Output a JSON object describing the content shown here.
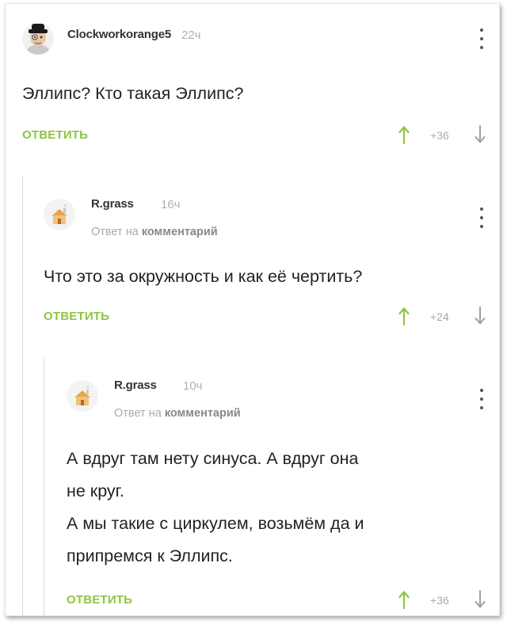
{
  "comments": [
    {
      "author": "Clockworkorange5",
      "time": "22ч",
      "reply_to": "",
      "text": [
        "Эллипс? Кто такая Эллипс?"
      ],
      "reply_label": "ОТВЕТИТЬ",
      "score": "+36"
    },
    {
      "author": "R.grass",
      "time": "16ч",
      "reply_to_prefix": "Ответ на",
      "reply_to_link": "комментарий",
      "text": [
        "Что это за окружность и как её чертить?"
      ],
      "reply_label": "ОТВЕТИТЬ",
      "score": "+24"
    },
    {
      "author": "R.grass",
      "time": "10ч",
      "reply_to_prefix": "Ответ на",
      "reply_to_link": "комментарий",
      "text": [
        "А вдруг там нету синуса. А вдруг она",
        "не круг.",
        "А мы такие с циркулем, возьмём да и",
        "припремся к Эллипс."
      ],
      "reply_label": "ОТВЕТИТЬ",
      "score": "+36"
    }
  ],
  "colors": {
    "accent_green": "#8dc63f",
    "muted": "#aaaaaa",
    "thread_line": "#d9d9d9"
  },
  "icons": {
    "avatar_1": "clockwork-orange-avatar",
    "avatar_2": "house-avatar",
    "upvote": "arrow-up-icon",
    "downvote": "arrow-down-icon",
    "menu": "kebab-menu-icon"
  }
}
